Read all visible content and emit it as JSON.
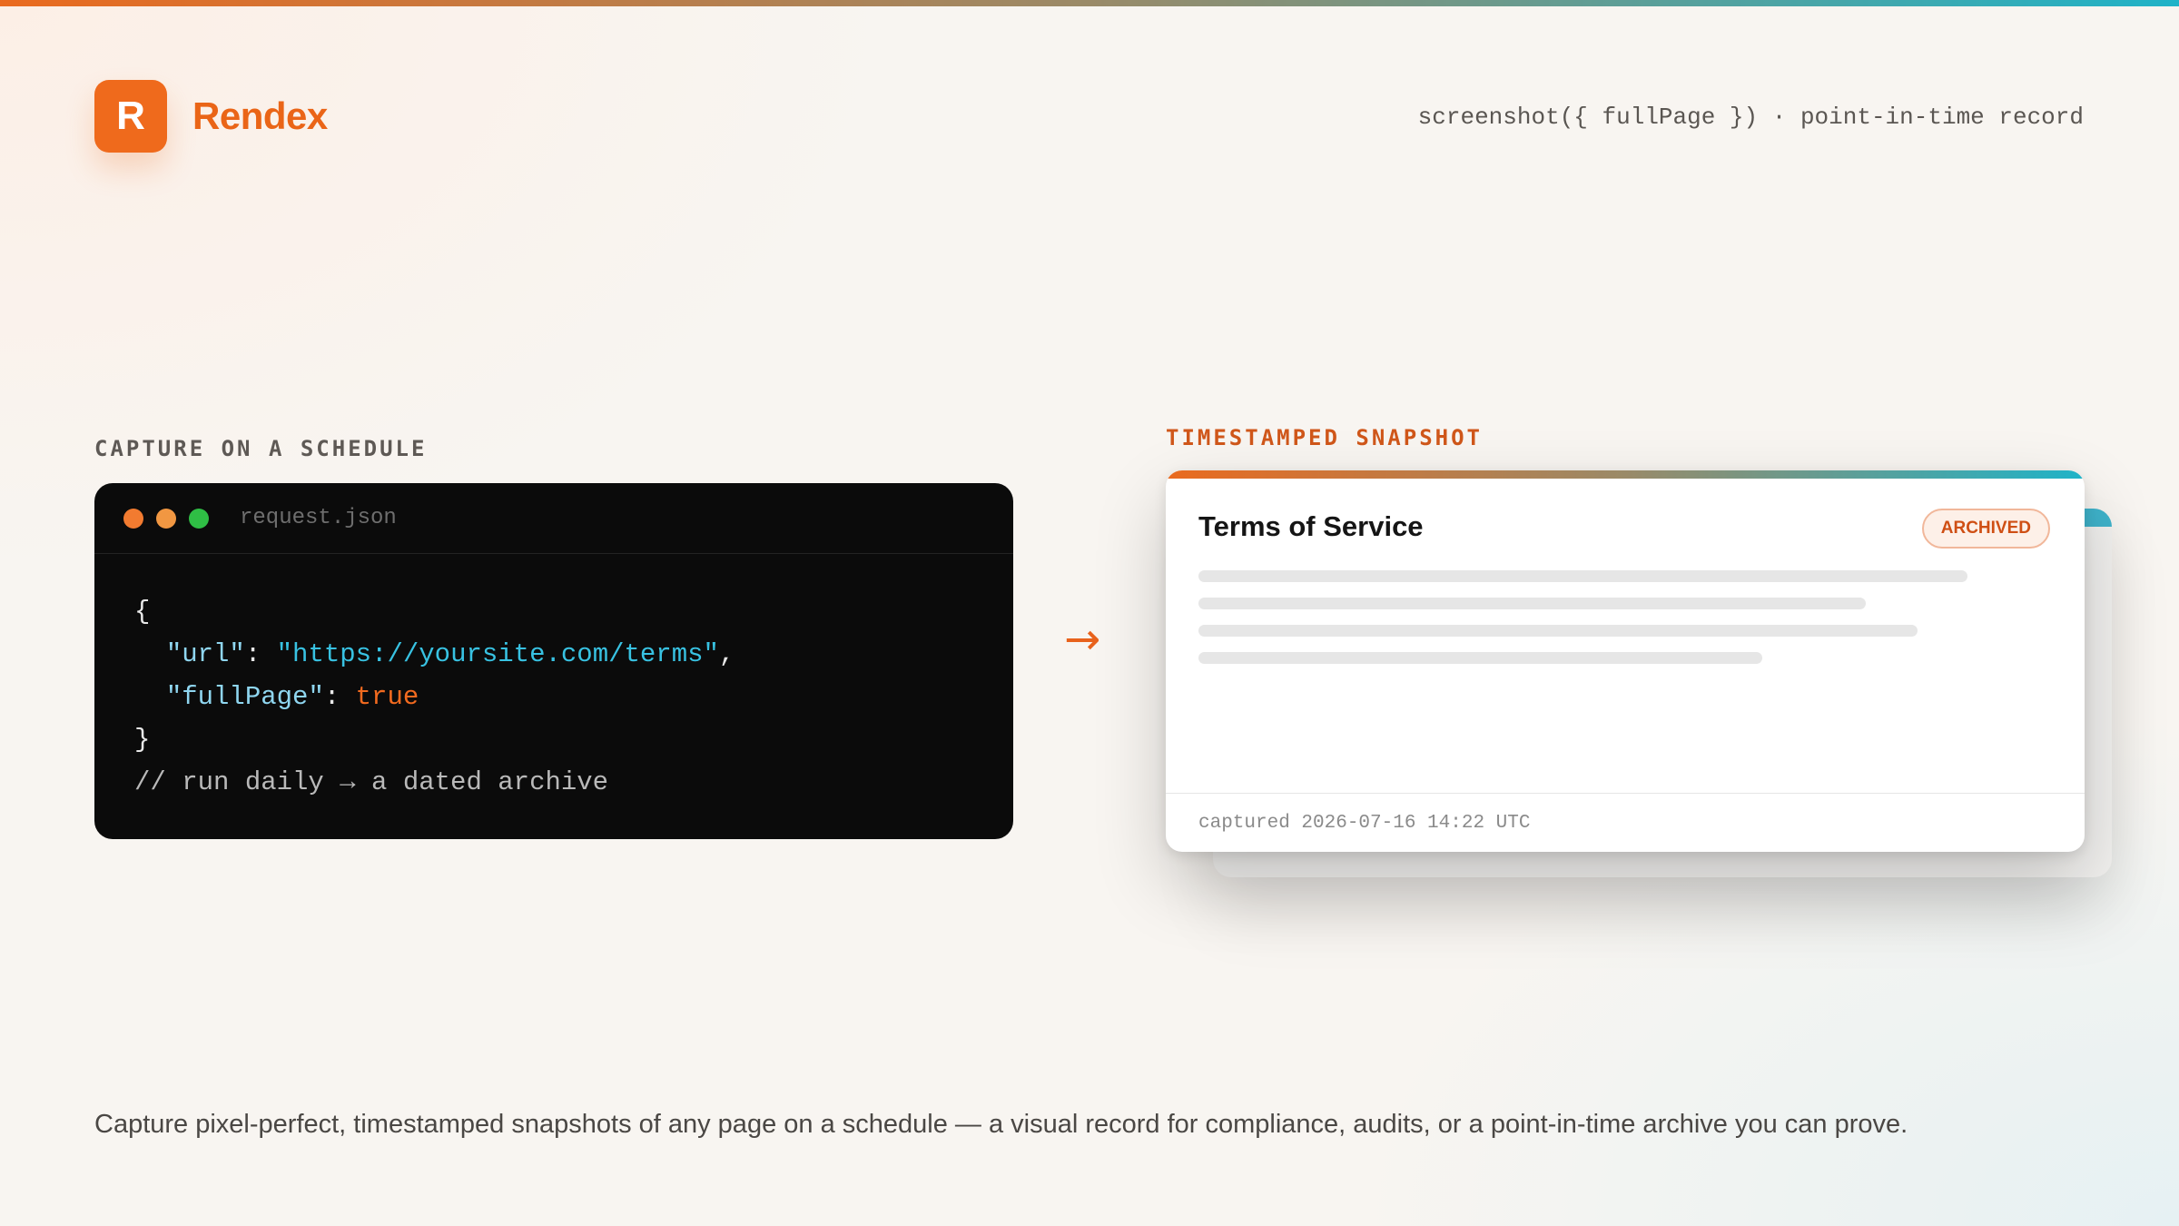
{
  "header": {
    "logo_letter": "R",
    "brand_name": "Rendex",
    "tagline": "screenshot({ fullPage }) · point-in-time record"
  },
  "left_section": {
    "label": "CAPTURE ON A SCHEDULE",
    "filename": "request.json",
    "code": {
      "open_brace": "{",
      "url_key": "\"url\"",
      "url_value": "\"https://yoursite.com/terms\"",
      "fullpage_key": "\"fullPage\"",
      "fullpage_value": "true",
      "close_brace": "}",
      "comment": "// run daily → a dated archive"
    }
  },
  "arrow": "→",
  "right_section": {
    "label": "TIMESTAMPED SNAPSHOT",
    "card_title": "Terms of Service",
    "badge": "ARCHIVED",
    "captured": "captured 2026-07-16 14:22 UTC"
  },
  "caption": "Capture pixel-perfect, timestamped snapshots of any page on a schedule — a visual record for compliance, audits, or a point-in-time archive you can prove.",
  "colors": {
    "brand_orange": "#ef6a1c",
    "accent_teal": "#1fb3c8",
    "code_bg": "#0b0b0b"
  }
}
